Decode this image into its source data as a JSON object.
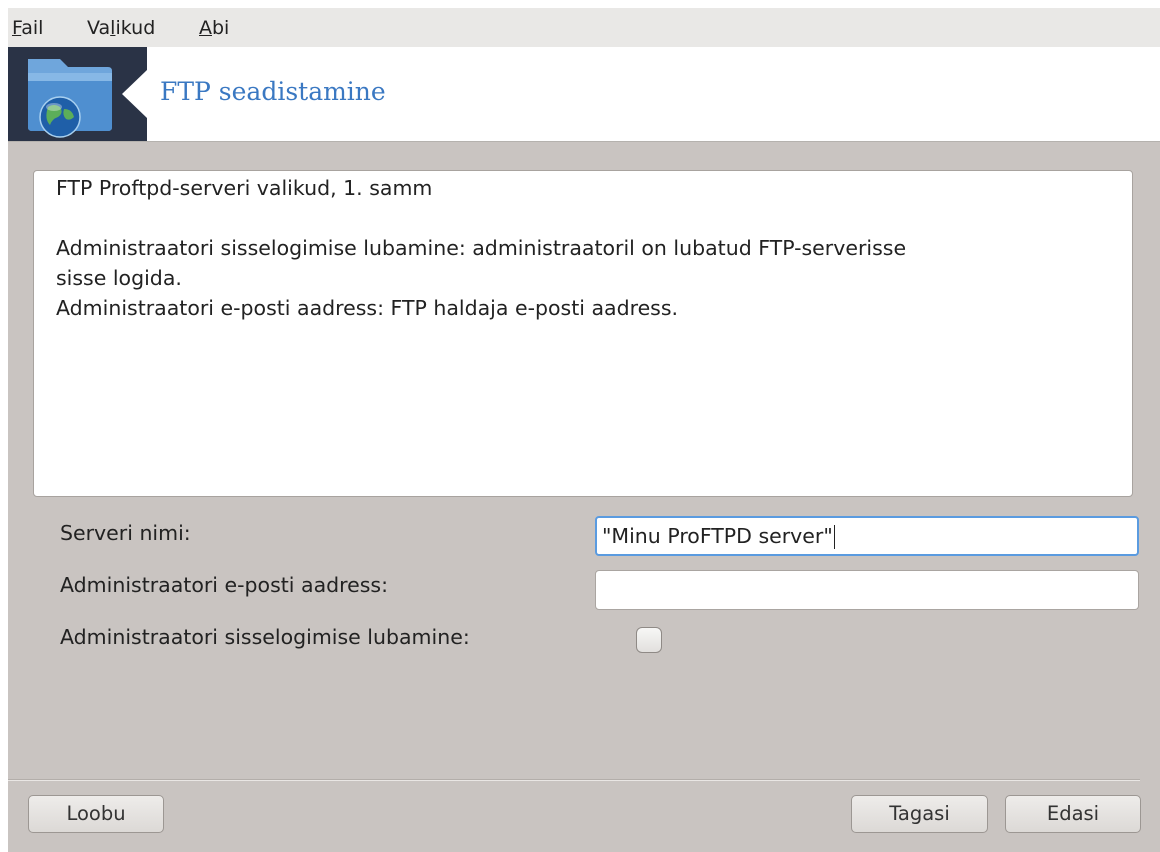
{
  "menubar": {
    "items": [
      {
        "accel": "F",
        "rest": "ail"
      },
      {
        "before": "Va",
        "accel": "l",
        "rest": "ikud"
      },
      {
        "accel": "A",
        "rest": "bi"
      }
    ]
  },
  "banner": {
    "title": "FTP seadistamine",
    "logo_icon": "folder-globe-icon"
  },
  "info": {
    "heading": "FTP Proftpd-serveri valikud, 1. samm",
    "line1": "Administraatori sisselogimise lubamine: administraatoril on lubatud FTP-serverisse",
    "line2": "sisse logida.",
    "line3": "Administraatori e-posti aadress: FTP haldaja e-posti aadress."
  },
  "form": {
    "server_name_label": "Serveri nimi:",
    "server_name_value": "\"Minu ProFTPD server\"",
    "admin_email_label": "Administraatori e-posti aadress:",
    "admin_email_value": "",
    "admin_login_label": "Administraatori sisselogimise lubamine:",
    "admin_login_checked": false
  },
  "buttons": {
    "cancel": "Loobu",
    "back": "Tagasi",
    "next": "Edasi"
  },
  "colors": {
    "window_bg": "#c9c4c1",
    "title_blue": "#3a78c2",
    "logo_bg": "#2a3346",
    "focus_blue": "#5a9be0"
  }
}
